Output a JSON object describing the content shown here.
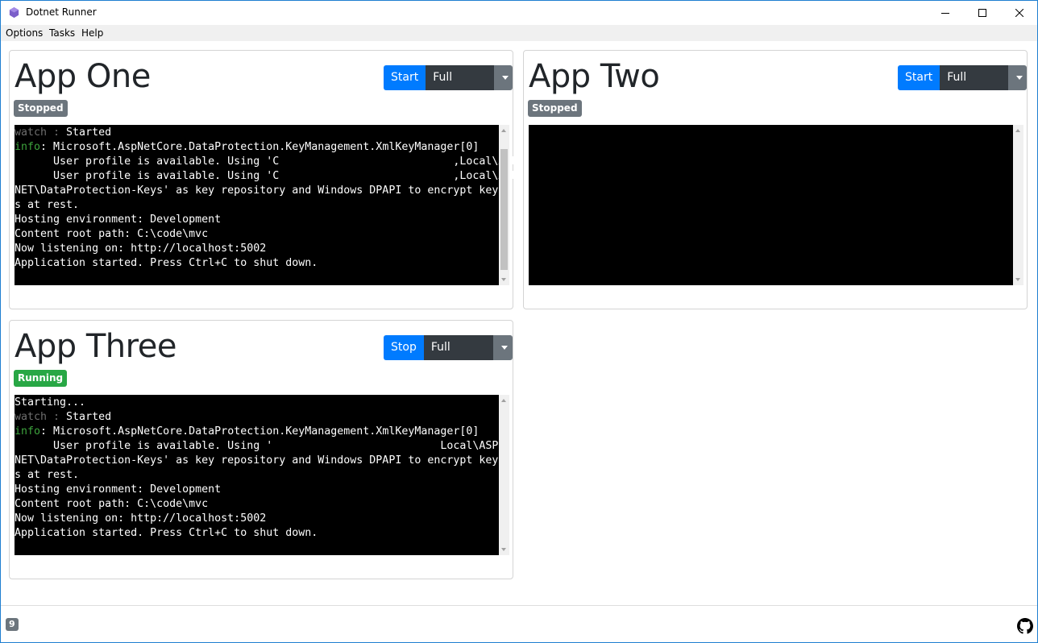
{
  "window": {
    "title": "Dotnet Runner",
    "icon": "hexagon-app-icon"
  },
  "menu": {
    "items": [
      "Options",
      "Tasks",
      "Help"
    ]
  },
  "apps": [
    {
      "name": "App One",
      "action_label": "Start",
      "fullscreen_label": "Full Screen",
      "status": "Stopped",
      "console": [
        {
          "prefix": "watch : ",
          "prefix_style": "dim",
          "text": "Started"
        },
        {
          "prefix": "info",
          "prefix_style": "info",
          "text": ": Microsoft.AspNetCore.DataProtection.KeyManagement.XmlKeyManager[0]"
        },
        {
          "text": "      User profile is available. Using 'C                           ,Local\\ASP."
        },
        {
          "text": "      User profile is available. Using 'C                           ,Local\\ASP."
        },
        {
          "text": "NET\\DataProtection-Keys' as key repository and Windows DPAPI to encrypt key"
        },
        {
          "text": "s at rest."
        },
        {
          "text": "Hosting environment: Development"
        },
        {
          "text": "Content root path: C:\\code\\mvc"
        },
        {
          "text": "Now listening on: http://localhost:5002"
        },
        {
          "text": "Application started. Press Ctrl+C to shut down."
        }
      ]
    },
    {
      "name": "App Two",
      "action_label": "Start",
      "fullscreen_label": "Full Screen",
      "status": "Stopped",
      "console": []
    },
    {
      "name": "App Three",
      "action_label": "Stop",
      "fullscreen_label": "Full Screen",
      "status": "Running",
      "console": [
        {
          "text": "Starting..."
        },
        {
          "prefix": "watch : ",
          "prefix_style": "dim",
          "text": "Started"
        },
        {
          "prefix": "info",
          "prefix_style": "info",
          "text": ": Microsoft.AspNetCore.DataProtection.KeyManagement.XmlKeyManager[0]"
        },
        {
          "text": "      User profile is available. Using '                          Local\\ASP."
        },
        {
          "text": "NET\\DataProtection-Keys' as key repository and Windows DPAPI to encrypt key"
        },
        {
          "text": "s at rest."
        },
        {
          "text": "Hosting environment: Development"
        },
        {
          "text": "Content root path: C:\\code\\mvc"
        },
        {
          "text": "Now listening on: http://localhost:5002"
        },
        {
          "text": "Application started. Press Ctrl+C to shut down."
        }
      ]
    }
  ],
  "footer": {
    "count_badge": "9",
    "github_icon": "github-icon"
  },
  "colors": {
    "primary": "#007bff",
    "dark": "#343a40",
    "secondary": "#6c757d",
    "success": "#28a745",
    "console_bg": "#000000",
    "info_green": "#3da33d"
  }
}
